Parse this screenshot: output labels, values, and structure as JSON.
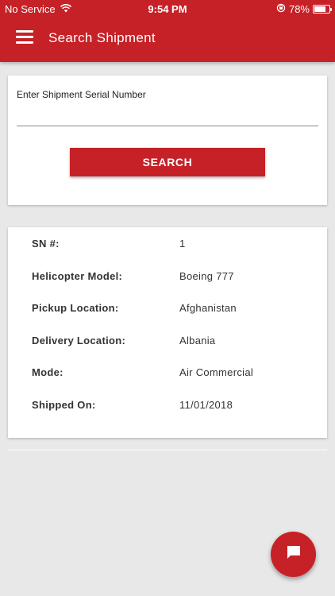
{
  "status_bar": {
    "carrier": "No Service",
    "time": "9:54 PM",
    "battery": "78%",
    "battery_level": 0.78
  },
  "app_bar": {
    "title": "Search Shipment",
    "menu_icon": "hamburger-menu-icon"
  },
  "search": {
    "label": "Enter Shipment Serial Number",
    "input_value": "",
    "button_label": "SEARCH"
  },
  "details": {
    "rows": [
      {
        "label": "SN #:",
        "value": "1"
      },
      {
        "label": "Helicopter Model:",
        "value": "Boeing 777"
      },
      {
        "label": "Pickup Location:",
        "value": "Afghanistan"
      },
      {
        "label": "Delivery Location:",
        "value": "Albania"
      },
      {
        "label": "Mode:",
        "value": "Air Commercial"
      },
      {
        "label": "Shipped On:",
        "value": "11/01/2018"
      }
    ]
  },
  "fab": {
    "icon": "chat-icon"
  },
  "colors": {
    "primary": "#c62127",
    "background": "#e8e8e8"
  }
}
